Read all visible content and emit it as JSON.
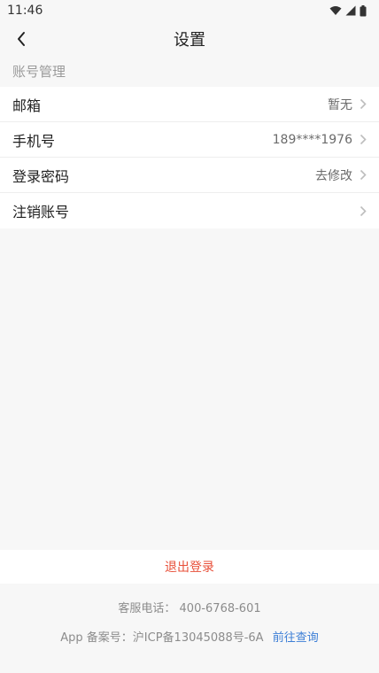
{
  "status_bar": {
    "time": "11:46",
    "icons": [
      "wifi-icon",
      "signal-icon",
      "battery-icon"
    ]
  },
  "nav": {
    "back_icon": "chevron-left-icon",
    "title": "设置"
  },
  "section": {
    "header": "账号管理"
  },
  "rows": [
    {
      "label": "邮箱",
      "value": "暂无"
    },
    {
      "label": "手机号",
      "value": "189****1976"
    },
    {
      "label": "登录密码",
      "value": "去修改"
    },
    {
      "label": "注销账号",
      "value": ""
    }
  ],
  "logout": {
    "label": "退出登录",
    "color": "#e8503a"
  },
  "footer": {
    "phone_label": "客服电话：",
    "phone_number": "400-6768-601",
    "icp_text": "App 备案号：沪ICP备13045088号-6A",
    "icp_link": "前往查询",
    "link_color": "#3d7fd6"
  }
}
